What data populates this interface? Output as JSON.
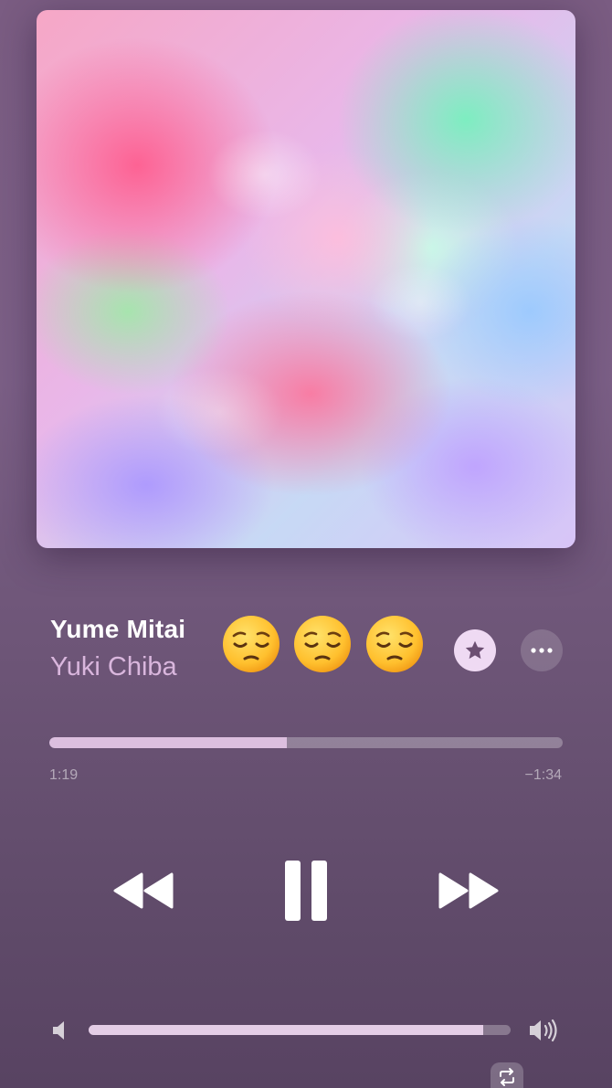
{
  "track": {
    "title": "Yume Mitai",
    "artist": "Yuki Chiba",
    "emoji": [
      "pensive-face-emoji",
      "pensive-face-emoji",
      "pensive-face-emoji"
    ]
  },
  "playback": {
    "elapsed": "1:19",
    "remaining": "−1:34",
    "progress_fraction": 0.463,
    "state": "playing"
  },
  "volume": {
    "level_fraction": 0.935
  },
  "icons": {
    "favorite": "star-icon",
    "more": "ellipsis-icon",
    "rewind": "rewind-icon",
    "pause": "pause-icon",
    "forward": "fast-forward-icon",
    "volume_low": "speaker-low-icon",
    "volume_high": "speaker-high-icon",
    "repeat": "repeat-icon"
  },
  "colors": {
    "artist_text": "#d9b6dd",
    "progress_fill": "#dcbfdf",
    "favorite_button": "#efdaf3"
  }
}
